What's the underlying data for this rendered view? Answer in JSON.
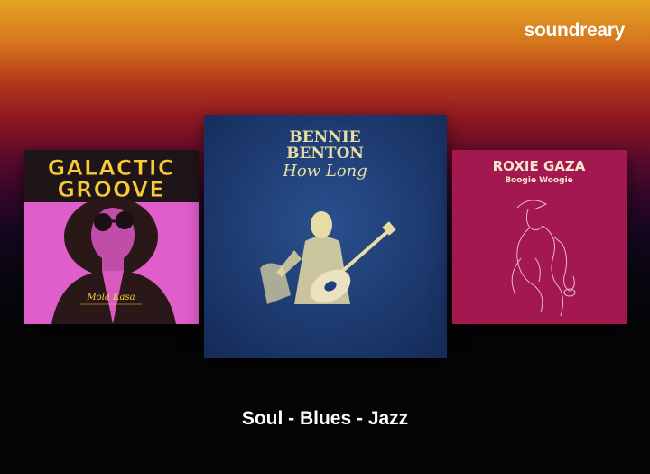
{
  "brand": {
    "name": "soundreary"
  },
  "albums": [
    {
      "title": "GALACTIC",
      "title2": "GROOVE",
      "artist": "Mola Kasa",
      "colors": {
        "background": "#e05ec9",
        "title": "#f5cd35",
        "outline": "#2a1818"
      }
    },
    {
      "artist": "BENNIE",
      "artist2": "BENTON",
      "title": "How Long",
      "colors": {
        "background": "#1e3f7c",
        "text": "#e7dca4"
      }
    },
    {
      "artist": "ROXIE GAZA",
      "title": "Boogie Woogie",
      "colors": {
        "background": "#a3184f",
        "text": "#f7e6cf",
        "line": "#e9b9cf"
      }
    }
  ],
  "genre_caption": "Soul - Blues - Jazz"
}
